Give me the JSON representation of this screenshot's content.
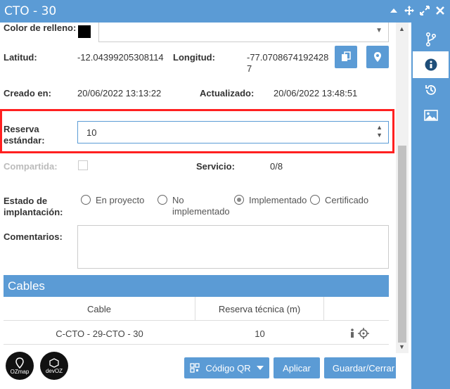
{
  "window": {
    "title": "CTO - 30",
    "controls": [
      "minimize",
      "move",
      "expand",
      "close"
    ]
  },
  "form": {
    "color_label": "Color de relleno:",
    "color_value": "#000000",
    "lat_label": "Latitud:",
    "lat_value": "-12.04399205308114",
    "lng_label": "Longitud:",
    "lng_value_line1": "-77.0708674192428",
    "lng_value_line2": "7",
    "created_label": "Creado en:",
    "created_value": "20/06/2022 13:13:22",
    "updated_label": "Actualizado:",
    "updated_value": "20/06/2022 13:48:51",
    "reserva_label_line1": "Reserva",
    "reserva_label_line2": "estándar:",
    "reserva_value": "10",
    "compartida_label": "Compartida:",
    "servicio_label": "Servicio:",
    "servicio_value": "0/8",
    "estado_label_line1": "Estado de",
    "estado_label_line2": "implantación:",
    "estado_options": [
      "En proyecto",
      "No",
      "implementado",
      "Implementado",
      "Certificado"
    ],
    "estado_selected": "Implementado",
    "comentarios_label": "Comentarios:"
  },
  "cables": {
    "title": "Cables",
    "columns": [
      "Cable",
      "Reserva técnica (m)",
      ""
    ],
    "rows": [
      {
        "cable": "C-CTO - 29-CTO - 30",
        "reserva": "10"
      }
    ]
  },
  "footer": {
    "logo1": "OZmap",
    "logo2": "devOZ",
    "qr_label": "Código QR",
    "apply_label": "Aplicar",
    "save_label": "Guardar/Cerrar"
  },
  "rightbar": {
    "items": [
      "branch-icon",
      "info-icon",
      "history-icon",
      "image-icon"
    ],
    "active": "info-icon"
  }
}
